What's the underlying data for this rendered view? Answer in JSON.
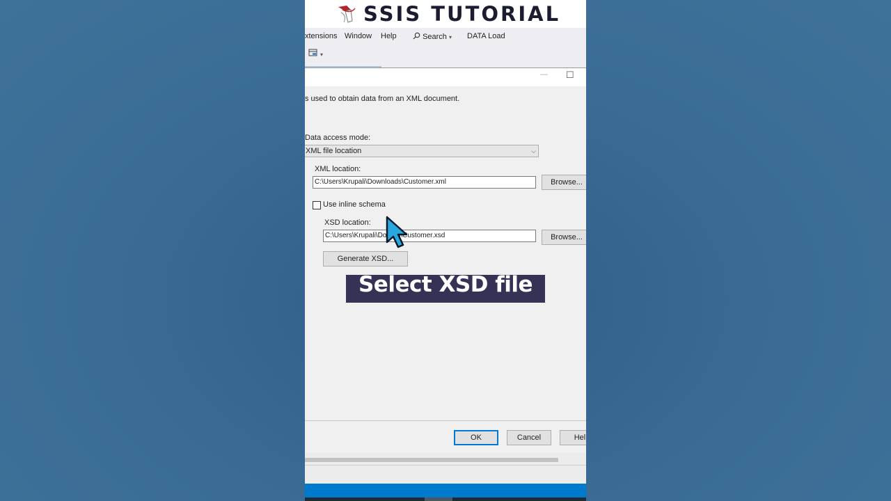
{
  "banner": {
    "title": "SSIS TUTORIAL",
    "logo_icon": "ssis-logo-icon"
  },
  "menu": {
    "items": [
      "xtensions",
      "Window",
      "Help",
      "Search",
      "DATA Load"
    ]
  },
  "toolbar": {
    "icon": "layout-icon"
  },
  "dialog": {
    "title_buttons": {
      "minimize": "—",
      "maximize": "☐"
    },
    "description": "s used to obtain data from an XML document.",
    "data_access_mode": {
      "label": "Data access mode:",
      "value": "XML file location"
    },
    "xml_location": {
      "label": "XML location:",
      "value": "C:\\Users\\Krupali\\Downloads\\Customer.xml",
      "browse": "Browse..."
    },
    "inline_schema": {
      "label": "Use inline schema",
      "checked": false
    },
    "xsd_location": {
      "label": "XSD location:",
      "value": "C:\\Users\\Krupali\\Dov     s\\Customer.xsd",
      "browse": "Browse..."
    },
    "generate_xsd": "Generate XSD...",
    "buttons": {
      "ok": "OK",
      "cancel": "Cancel",
      "help": "Help"
    }
  },
  "overlay": {
    "caption": "Select XSD file"
  },
  "colors": {
    "accent": "#0078d7",
    "caption_bg": "#353256",
    "status_bar": "#007acc",
    "cursor": "#29a8e0"
  }
}
